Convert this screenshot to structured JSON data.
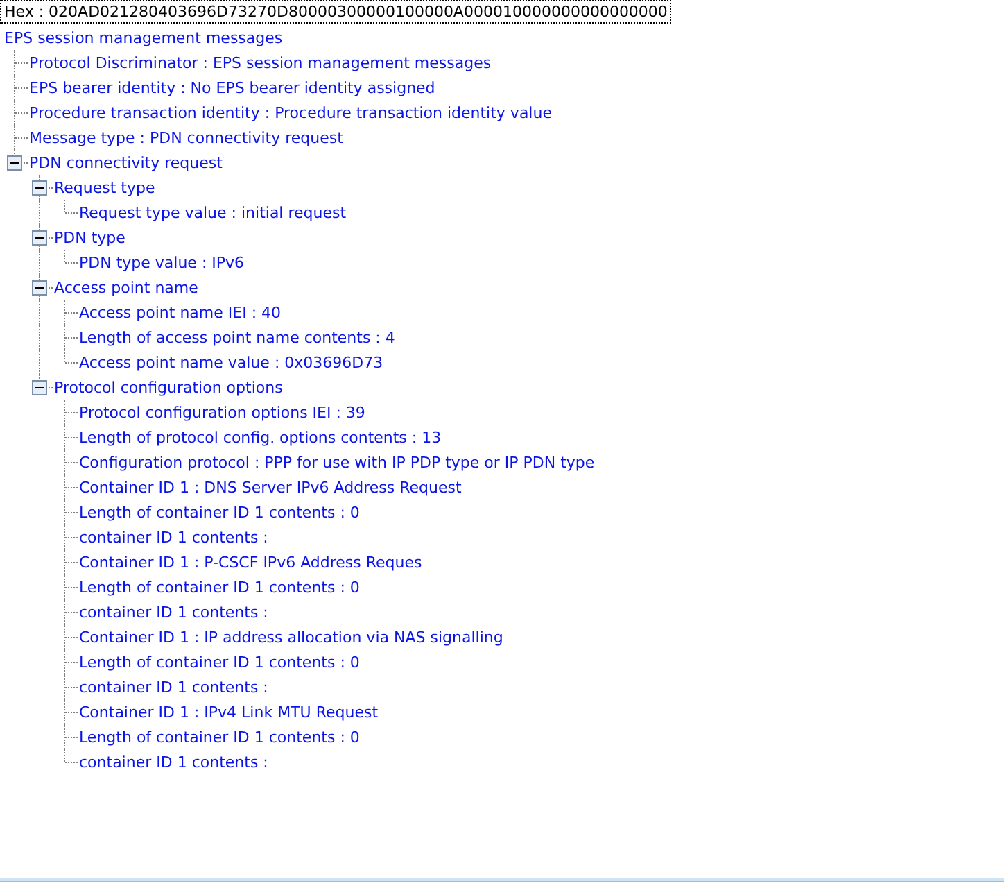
{
  "hex_bar": {
    "text": "Hex : 020AD021280403696D73270D80000300000100000A000010000000000000000"
  },
  "tree": {
    "label": "EPS session management messages",
    "children": [
      {
        "label": "Protocol Discriminator : EPS session management messages"
      },
      {
        "label": "EPS bearer identity : No EPS bearer identity assigned"
      },
      {
        "label": "Procedure transaction identity : Procedure transaction identity value"
      },
      {
        "label": "Message type : PDN connectivity request"
      },
      {
        "label": "PDN connectivity request",
        "expanded": true,
        "children": [
          {
            "label": "Request type",
            "expanded": true,
            "children": [
              {
                "label": "Request type value : initial request"
              }
            ]
          },
          {
            "label": "PDN type",
            "expanded": true,
            "children": [
              {
                "label": "PDN type value : IPv6"
              }
            ]
          },
          {
            "label": "Access point name",
            "expanded": true,
            "children": [
              {
                "label": "Access point name IEI : 40"
              },
              {
                "label": "Length of access point name contents : 4"
              },
              {
                "label": "Access point name value : 0x03696D73"
              }
            ]
          },
          {
            "label": "Protocol configuration options",
            "expanded": true,
            "children": [
              {
                "label": "Protocol configuration options IEI : 39"
              },
              {
                "label": "Length of protocol config. options contents : 13"
              },
              {
                "label": "Configuration protocol : PPP for use with IP PDP type or IP PDN type"
              },
              {
                "label": "Container ID 1 : DNS Server IPv6 Address Request"
              },
              {
                "label": "Length of container ID 1 contents : 0"
              },
              {
                "label": "container ID 1 contents :"
              },
              {
                "label": "Container ID 1 : P-CSCF IPv6 Address Reques"
              },
              {
                "label": "Length of container ID 1 contents : 0"
              },
              {
                "label": "container ID 1 contents :"
              },
              {
                "label": "Container ID 1 : IP address allocation via NAS signalling"
              },
              {
                "label": "Length of container ID 1 contents : 0"
              },
              {
                "label": "container ID 1 contents :"
              },
              {
                "label": "Container ID 1 : IPv4 Link MTU Request"
              },
              {
                "label": "Length of container ID 1 contents : 0"
              },
              {
                "label": "container ID 1 contents :"
              }
            ]
          }
        ]
      }
    ]
  }
}
